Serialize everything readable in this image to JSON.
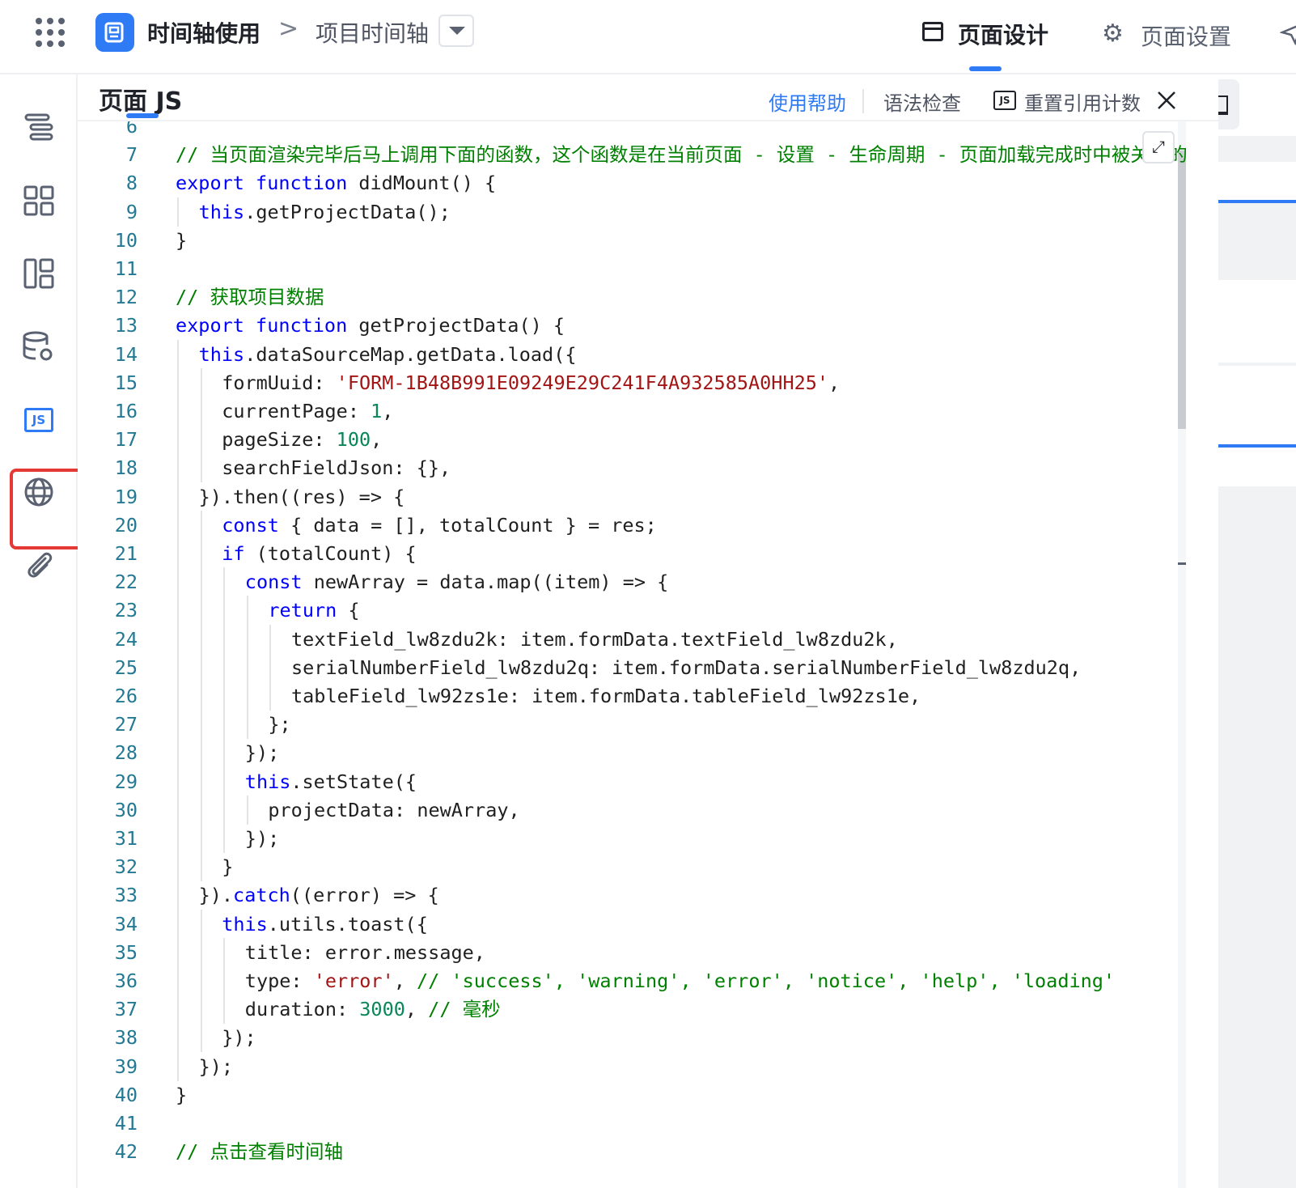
{
  "topbar": {
    "app_name": "时间轴使用",
    "breadcrumb_sep": ">",
    "breadcrumb_page": "项目时间轴",
    "tab_design": "页面设计",
    "tab_settings": "页面设置"
  },
  "panel": {
    "title": "页面 JS",
    "help_link": "使用帮助",
    "lint_button": "语法检查",
    "reset_icon": "JS",
    "reset_button": "重置引用计数",
    "expand_icon": "⤢"
  },
  "rail": {
    "items": [
      "outline-icon",
      "components-icon",
      "layout-icon",
      "datasource-icon",
      "js-icon",
      "global-icon",
      "attachment-icon"
    ],
    "js_label": "JS"
  },
  "code": {
    "lines": [
      {
        "n": "6",
        "indent": 0,
        "tokens": []
      },
      {
        "n": "7",
        "indent": 0,
        "tokens": [
          [
            "cm",
            "// 当页面渲染完毕后马上调用下面的函数，这个函数是在当前页面 - 设置 - 生命周期 - 页面加载完成时中被关联的"
          ]
        ]
      },
      {
        "n": "8",
        "indent": 0,
        "tokens": [
          [
            "kw",
            "export"
          ],
          [
            "pl",
            " "
          ],
          [
            "kw",
            "function"
          ],
          [
            "pl",
            " didMount() {"
          ]
        ]
      },
      {
        "n": "9",
        "indent": 1,
        "tokens": [
          [
            "kw",
            "this"
          ],
          [
            "pl",
            ".getProjectData();"
          ]
        ]
      },
      {
        "n": "10",
        "indent": 0,
        "tokens": [
          [
            "pl",
            "}"
          ]
        ]
      },
      {
        "n": "11",
        "indent": 0,
        "tokens": []
      },
      {
        "n": "12",
        "indent": 0,
        "tokens": [
          [
            "cm",
            "// 获取项目数据"
          ]
        ]
      },
      {
        "n": "13",
        "indent": 0,
        "tokens": [
          [
            "kw",
            "export"
          ],
          [
            "pl",
            " "
          ],
          [
            "kw",
            "function"
          ],
          [
            "pl",
            " getProjectData() {"
          ]
        ]
      },
      {
        "n": "14",
        "indent": 1,
        "tokens": [
          [
            "kw",
            "this"
          ],
          [
            "pl",
            ".dataSourceMap.getData.load({"
          ]
        ]
      },
      {
        "n": "15",
        "indent": 2,
        "tokens": [
          [
            "pl",
            "formUuid: "
          ],
          [
            "str",
            "'FORM-1B48B991E09249E29C241F4A932585A0HH25'"
          ],
          [
            "pl",
            ","
          ]
        ]
      },
      {
        "n": "16",
        "indent": 2,
        "tokens": [
          [
            "pl",
            "currentPage: "
          ],
          [
            "num",
            "1"
          ],
          [
            "pl",
            ","
          ]
        ]
      },
      {
        "n": "17",
        "indent": 2,
        "tokens": [
          [
            "pl",
            "pageSize: "
          ],
          [
            "num",
            "100"
          ],
          [
            "pl",
            ","
          ]
        ]
      },
      {
        "n": "18",
        "indent": 2,
        "tokens": [
          [
            "pl",
            "searchFieldJson: {},"
          ]
        ]
      },
      {
        "n": "19",
        "indent": 1,
        "tokens": [
          [
            "pl",
            "}).then((res) => {"
          ]
        ]
      },
      {
        "n": "20",
        "indent": 2,
        "tokens": [
          [
            "kw",
            "const"
          ],
          [
            "pl",
            " { data = [], totalCount } = res;"
          ]
        ]
      },
      {
        "n": "21",
        "indent": 2,
        "tokens": [
          [
            "kw",
            "if"
          ],
          [
            "pl",
            " (totalCount) {"
          ]
        ]
      },
      {
        "n": "22",
        "indent": 3,
        "tokens": [
          [
            "kw",
            "const"
          ],
          [
            "pl",
            " newArray = data.map((item) => {"
          ]
        ]
      },
      {
        "n": "23",
        "indent": 4,
        "tokens": [
          [
            "kw",
            "return"
          ],
          [
            "pl",
            " {"
          ]
        ]
      },
      {
        "n": "24",
        "indent": 5,
        "tokens": [
          [
            "pl",
            "textField_lw8zdu2k: item.formData.textField_lw8zdu2k,"
          ]
        ]
      },
      {
        "n": "25",
        "indent": 5,
        "tokens": [
          [
            "pl",
            "serialNumberField_lw8zdu2q: item.formData.serialNumberField_lw8zdu2q,"
          ]
        ]
      },
      {
        "n": "26",
        "indent": 5,
        "tokens": [
          [
            "pl",
            "tableField_lw92zs1e: item.formData.tableField_lw92zs1e,"
          ]
        ]
      },
      {
        "n": "27",
        "indent": 4,
        "tokens": [
          [
            "pl",
            "};"
          ]
        ]
      },
      {
        "n": "28",
        "indent": 3,
        "tokens": [
          [
            "pl",
            "});"
          ]
        ]
      },
      {
        "n": "29",
        "indent": 3,
        "tokens": [
          [
            "kw",
            "this"
          ],
          [
            "pl",
            ".setState({"
          ]
        ]
      },
      {
        "n": "30",
        "indent": 4,
        "tokens": [
          [
            "pl",
            "projectData: newArray,"
          ]
        ]
      },
      {
        "n": "31",
        "indent": 3,
        "tokens": [
          [
            "pl",
            "});"
          ]
        ]
      },
      {
        "n": "32",
        "indent": 2,
        "tokens": [
          [
            "pl",
            "}"
          ]
        ]
      },
      {
        "n": "33",
        "indent": 1,
        "tokens": [
          [
            "pl",
            "})."
          ],
          [
            "kw",
            "catch"
          ],
          [
            "pl",
            "((error) => {"
          ]
        ]
      },
      {
        "n": "34",
        "indent": 2,
        "tokens": [
          [
            "kw",
            "this"
          ],
          [
            "pl",
            ".utils.toast({"
          ]
        ]
      },
      {
        "n": "35",
        "indent": 3,
        "tokens": [
          [
            "pl",
            "title: error.message,"
          ]
        ]
      },
      {
        "n": "36",
        "indent": 3,
        "tokens": [
          [
            "pl",
            "type: "
          ],
          [
            "str",
            "'error'"
          ],
          [
            "pl",
            ", "
          ],
          [
            "cm",
            "// 'success', 'warning', 'error', 'notice', 'help', 'loading'"
          ]
        ]
      },
      {
        "n": "37",
        "indent": 3,
        "tokens": [
          [
            "pl",
            "duration: "
          ],
          [
            "num",
            "3000"
          ],
          [
            "pl",
            ", "
          ],
          [
            "cm",
            "// 毫秒"
          ]
        ]
      },
      {
        "n": "38",
        "indent": 2,
        "tokens": [
          [
            "pl",
            "});"
          ]
        ]
      },
      {
        "n": "39",
        "indent": 1,
        "tokens": [
          [
            "pl",
            "});"
          ]
        ]
      },
      {
        "n": "40",
        "indent": 0,
        "tokens": [
          [
            "pl",
            "}"
          ]
        ]
      },
      {
        "n": "41",
        "indent": 0,
        "tokens": []
      },
      {
        "n": "42",
        "indent": 0,
        "tokens": [
          [
            "cm",
            "// 点击查看时间轴"
          ]
        ]
      }
    ]
  },
  "colors": {
    "accent": "#2f7bf6",
    "highlight": "#e53935",
    "keyword": "#0000ff",
    "comment": "#008000",
    "string": "#a31515",
    "number": "#098658",
    "line_number": "#237893"
  }
}
